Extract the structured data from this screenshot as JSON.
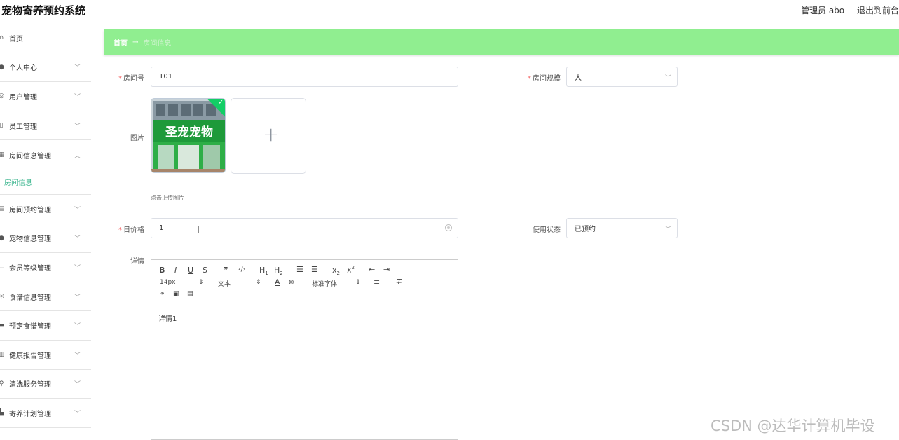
{
  "app": {
    "title": "宠物寄养预约系统",
    "user_label": "管理员 abo",
    "exit_label": "退出到前台"
  },
  "sidebar": {
    "items": [
      {
        "label": "首页",
        "icon": "home-icon",
        "chevron": ""
      },
      {
        "label": "个人中心",
        "icon": "user-icon",
        "chevron": "﹀"
      },
      {
        "label": "用户管理",
        "icon": "users-icon",
        "chevron": "﹀"
      },
      {
        "label": "员工管理",
        "icon": "staff-icon",
        "chevron": "﹀"
      },
      {
        "label": "房间信息管理",
        "icon": "room-icon",
        "chevron": "︿"
      }
    ],
    "active_sub": "房间信息",
    "items_after": [
      {
        "label": "房间预约管理",
        "icon": "calendar-icon",
        "chevron": "﹀"
      },
      {
        "label": "宠物信息管理",
        "icon": "pet-icon",
        "chevron": "﹀"
      },
      {
        "label": "会员等级管理",
        "icon": "member-icon",
        "chevron": "﹀"
      },
      {
        "label": "食谱信息管理",
        "icon": "recipe-icon",
        "chevron": "﹀"
      },
      {
        "label": "预定食谱管理",
        "icon": "order-icon",
        "chevron": "﹀"
      },
      {
        "label": "健康报告管理",
        "icon": "report-icon",
        "chevron": "﹀"
      },
      {
        "label": "清洗服务管理",
        "icon": "clean-icon",
        "chevron": "﹀"
      },
      {
        "label": "寄养计划管理",
        "icon": "plan-icon",
        "chevron": "﹀"
      }
    ]
  },
  "breadcrumb": {
    "home": "首页",
    "arrow": "→",
    "current": "房间信息"
  },
  "form": {
    "room_no_label": "房间号",
    "room_no_value": "101",
    "room_size_label": "房间规模",
    "room_size_value": "大",
    "image_label": "图片",
    "upload_hint": "点击上传图片",
    "image_sign_text": "圣宠宠物",
    "price_label": "日价格",
    "price_value": "1",
    "status_label": "使用状态",
    "status_value": "已预约",
    "detail_label": "详情",
    "required_mark": "*",
    "select_arrow": "﹀",
    "plus": "+",
    "check": "✓"
  },
  "editor": {
    "font_size": "14px",
    "text_type": "文本",
    "font_family": "标准字体",
    "content": "详情1"
  },
  "watermark": "CSDN @达华计算机毕设",
  "colors": {
    "breadcrumb_bg": "#90ee90",
    "active_menu": "#3bb58e",
    "required": "#f56c6c"
  }
}
